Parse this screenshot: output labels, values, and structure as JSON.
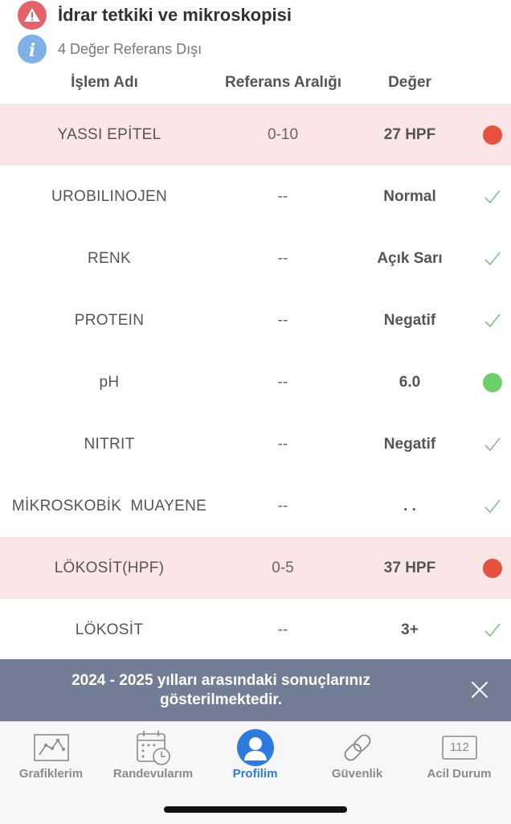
{
  "header": {
    "title": "İdrar tetkiki ve mikroskopisi",
    "title_icon": "warning-icon",
    "subtitle": "4 Değer Referans Dışı",
    "subtitle_icon": "info-icon"
  },
  "table": {
    "headers": [
      "İşlem Adı",
      "Referans Aralığı",
      "Değer"
    ],
    "rows": [
      {
        "name": "YASSI EPİTEL",
        "ref": "0-10",
        "value": "27 HPF",
        "status": "high",
        "status_icon": "red-dot-icon"
      },
      {
        "name": "UROBILINOJEN",
        "ref": "--",
        "value": "Normal",
        "status": "ok",
        "status_icon": "check-icon"
      },
      {
        "name": "RENK",
        "ref": "--",
        "value": "Açık Sarı",
        "status": "ok",
        "status_icon": "check-icon"
      },
      {
        "name": "PROTEIN",
        "ref": "--",
        "value": "Negatif",
        "status": "ok",
        "status_icon": "check-icon"
      },
      {
        "name": "pH",
        "ref": "--",
        "value": "6.0",
        "status": "normal",
        "status_icon": "green-dot-icon"
      },
      {
        "name": "NITRIT",
        "ref": "--",
        "value": "Negatif",
        "status": "ok",
        "status_icon": "check-icon"
      },
      {
        "name": "MİKROSKOBİK  MUAYENE",
        "ref": "--",
        "value": ". .",
        "status": "ok",
        "status_icon": "check-icon"
      },
      {
        "name": "LÖKOSİT(HPF)",
        "ref": "0-5",
        "value": "37 HPF",
        "status": "high",
        "status_icon": "red-dot-icon"
      },
      {
        "name": "LÖKOSİT",
        "ref": "--",
        "value": "3+",
        "status": "ok",
        "status_icon": "check-icon"
      }
    ]
  },
  "banner": {
    "line1": "2024 - 2025 yılları arasındaki sonuçlarınız",
    "line2": "gösterilmektedir.",
    "close_icon": "close-icon"
  },
  "tabbar": {
    "tabs": [
      {
        "label": "Grafiklerim",
        "icon": "chart-icon",
        "active": false
      },
      {
        "label": "Randevularım",
        "icon": "calendar-clock-icon",
        "active": false
      },
      {
        "label": "Profilim",
        "icon": "user-icon",
        "active": true
      },
      {
        "label": "Güvenlik",
        "icon": "link-icon",
        "active": false
      },
      {
        "label": "Acil Durum",
        "icon": "emergency-112-icon",
        "active": false
      }
    ],
    "emergency_number": "112"
  },
  "colors": {
    "flag_row_bg": "#fbe6e7",
    "red_dot": "#e8503f",
    "green_dot": "#6ccf6a",
    "check": "#7ec77a",
    "banner_bg": "#737d95",
    "active_tab": "#2e7be0"
  }
}
